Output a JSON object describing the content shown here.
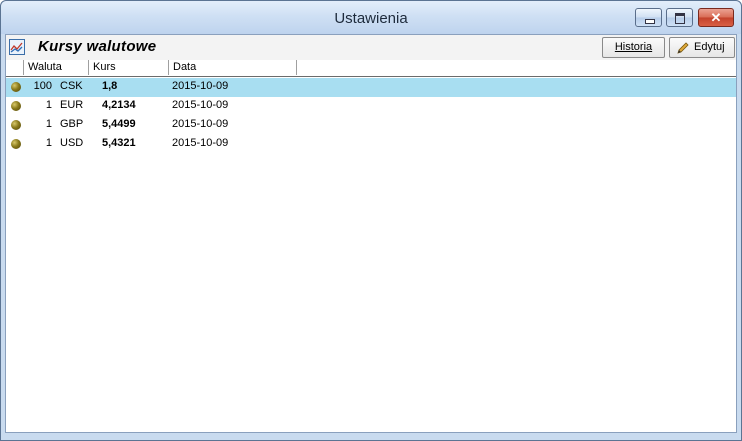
{
  "window": {
    "title": "Ustawienia"
  },
  "toolbar": {
    "title": "Kursy walutowe",
    "historia_label": "Historia",
    "edytuj_label": "Edytuj"
  },
  "table": {
    "headers": [
      "Waluta",
      "Kurs",
      "Data"
    ],
    "rows": [
      {
        "units": "100",
        "code": "CSK",
        "rate": "1,8",
        "date": "2015-10-09",
        "selected": true
      },
      {
        "units": "1",
        "code": "EUR",
        "rate": "4,2134",
        "date": "2015-10-09",
        "selected": false
      },
      {
        "units": "1",
        "code": "GBP",
        "rate": "5,4499",
        "date": "2015-10-09",
        "selected": false
      },
      {
        "units": "1",
        "code": "USD",
        "rate": "5,4321",
        "date": "2015-10-09",
        "selected": false
      }
    ]
  },
  "icons": {
    "toolbar": "chart-icon",
    "edit": "pencil-icon",
    "row_status": "status-dot-icon"
  },
  "colors": {
    "selection": "#a8def1",
    "status_dot": "#8a7a1a"
  }
}
